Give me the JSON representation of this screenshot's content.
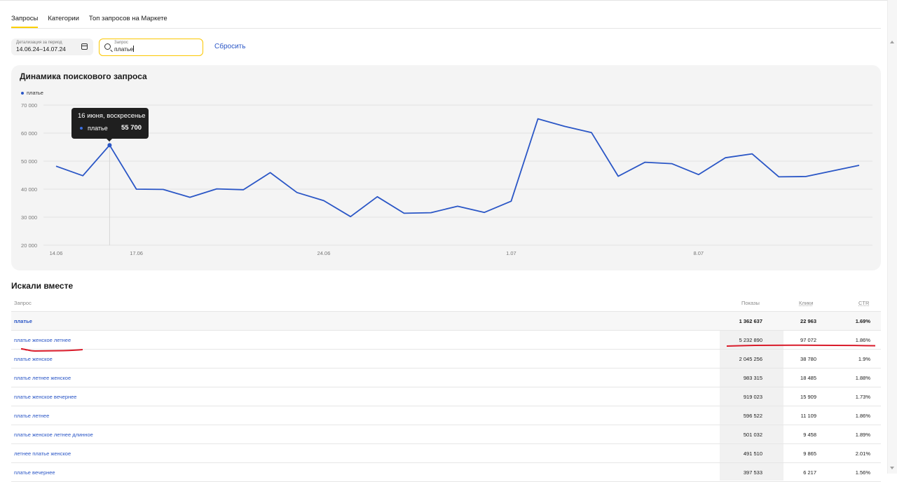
{
  "tabs": [
    {
      "label": "Запросы",
      "active": true
    },
    {
      "label": "Категории",
      "active": false
    },
    {
      "label": "Топ запросов на Маркете",
      "active": false
    }
  ],
  "filters": {
    "period_label": "Детализация за период",
    "period_value": "14.06.24–14.07.24",
    "query_label": "Запрос",
    "query_value": "платье",
    "reset_label": "Сбросить"
  },
  "chart_card": {
    "title": "Динамика поискового запроса",
    "legend": "платье"
  },
  "tooltip": {
    "date": "16 июня, воскресенье",
    "series": "платье",
    "value": "55 700"
  },
  "colors": {
    "line": "#2a56c6",
    "accent": "#fcd000",
    "link": "#2a56c6",
    "annotation": "#d91b2a"
  },
  "chart_data": {
    "type": "line",
    "x": [
      "14.06",
      "15.06",
      "16.06",
      "17.06",
      "18.06",
      "19.06",
      "20.06",
      "21.06",
      "22.06",
      "23.06",
      "24.06",
      "25.06",
      "26.06",
      "27.06",
      "28.06",
      "29.06",
      "30.06",
      "1.07",
      "2.07",
      "3.07",
      "4.07",
      "5.07",
      "6.07",
      "7.07",
      "8.07",
      "9.07",
      "10.07",
      "11.07",
      "12.07",
      "13.07",
      "14.07"
    ],
    "x_tick_labels": [
      "14.06",
      "17.06",
      "24.06",
      "1.07",
      "8.07"
    ],
    "y_tick_labels": [
      "20 000",
      "30 000",
      "40 000",
      "50 000",
      "60 000",
      "70 000"
    ],
    "series": [
      {
        "name": "платье",
        "values": [
          48200,
          44800,
          55700,
          40000,
          39900,
          37100,
          40100,
          39800,
          45900,
          38800,
          35900,
          30200,
          37300,
          31400,
          31600,
          33900,
          31700,
          35700,
          65100,
          62400,
          60200,
          44600,
          49600,
          49100,
          45200,
          51200,
          52600,
          44400,
          44500,
          46500,
          48500
        ]
      }
    ],
    "ylim": [
      20000,
      70000
    ],
    "grid": true,
    "legend": "top-left",
    "highlight_index": 2
  },
  "related": {
    "title": "Искали вместе",
    "columns": {
      "query": "Запрос",
      "shows": "Показы",
      "clicks": "Клики",
      "ctr": "CTR"
    },
    "rows": [
      {
        "query": "платье",
        "shows": "1 362 637",
        "clicks": "22 963",
        "ctr": "1.69%"
      },
      {
        "query": "платье женское летнее",
        "shows": "5 232 890",
        "clicks": "97 072",
        "ctr": "1.86%"
      },
      {
        "query": "платье женское",
        "shows": "2 045 256",
        "clicks": "38 780",
        "ctr": "1.9%"
      },
      {
        "query": "платье летнее женское",
        "shows": "983 315",
        "clicks": "18 485",
        "ctr": "1.88%"
      },
      {
        "query": "платье женское вечернее",
        "shows": "919 023",
        "clicks": "15 909",
        "ctr": "1.73%"
      },
      {
        "query": "платье летнее",
        "shows": "596 522",
        "clicks": "11 109",
        "ctr": "1.86%"
      },
      {
        "query": "платье женское летнее длинное",
        "shows": "501 032",
        "clicks": "9 458",
        "ctr": "1.89%"
      },
      {
        "query": "летнее платье женское",
        "shows": "491 510",
        "clicks": "9 865",
        "ctr": "2.01%"
      },
      {
        "query": "платье вечернее",
        "shows": "397 533",
        "clicks": "6 217",
        "ctr": "1.56%"
      }
    ]
  }
}
